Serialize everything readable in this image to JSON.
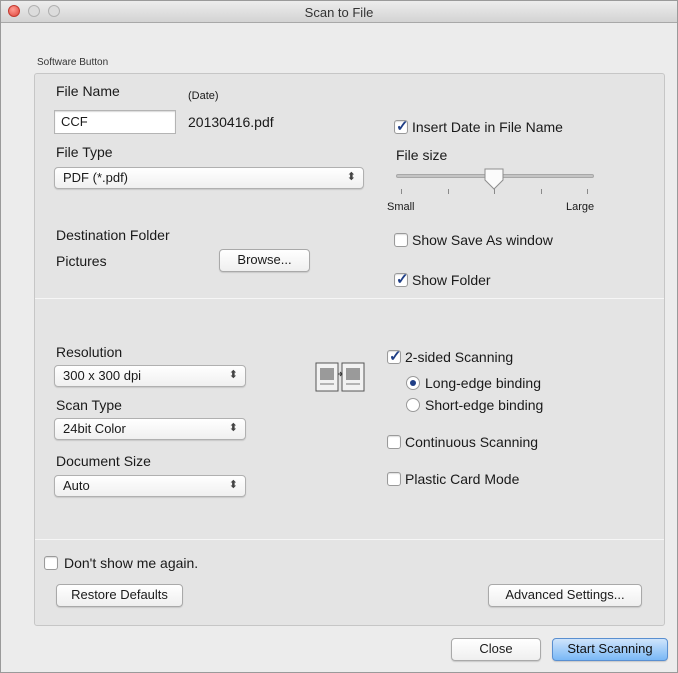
{
  "window": {
    "title": "Scan to File"
  },
  "group": {
    "label": "Software Button"
  },
  "file_name": {
    "label": "File Name",
    "date_label": "(Date)",
    "value": "CCF",
    "date_value": "20130416.pdf"
  },
  "insert_date": {
    "label": "Insert Date in File Name",
    "checked": true
  },
  "file_type": {
    "label": "File Type",
    "selected": "PDF (*.pdf)"
  },
  "file_size": {
    "label": "File size",
    "min_label": "Small",
    "max_label": "Large",
    "level": 0.5
  },
  "destination": {
    "label": "Destination Folder",
    "folder": "Pictures",
    "browse_label": "Browse..."
  },
  "show_save_as": {
    "label": "Show Save As window",
    "checked": false
  },
  "show_folder": {
    "label": "Show Folder",
    "checked": true
  },
  "resolution": {
    "label": "Resolution",
    "selected": "300 x 300 dpi"
  },
  "scan_type": {
    "label": "Scan Type",
    "selected": "24bit Color"
  },
  "document_size": {
    "label": "Document Size",
    "selected": "Auto"
  },
  "two_sided": {
    "label": "2-sided Scanning",
    "checked": true,
    "icon": "two-sided-pages-icon",
    "long_edge_label": "Long-edge binding",
    "short_edge_label": "Short-edge binding",
    "binding": "long"
  },
  "continuous": {
    "label": "Continuous Scanning",
    "checked": false
  },
  "plastic_card": {
    "label": "Plastic Card Mode",
    "checked": false
  },
  "dont_show": {
    "label": "Don't show me again.",
    "checked": false
  },
  "buttons": {
    "restore": "Restore Defaults",
    "advanced": "Advanced Settings...",
    "close": "Close",
    "start": "Start Scanning"
  },
  "colors": {
    "accent": "#7ab8f6",
    "check": "#1f3e86"
  }
}
